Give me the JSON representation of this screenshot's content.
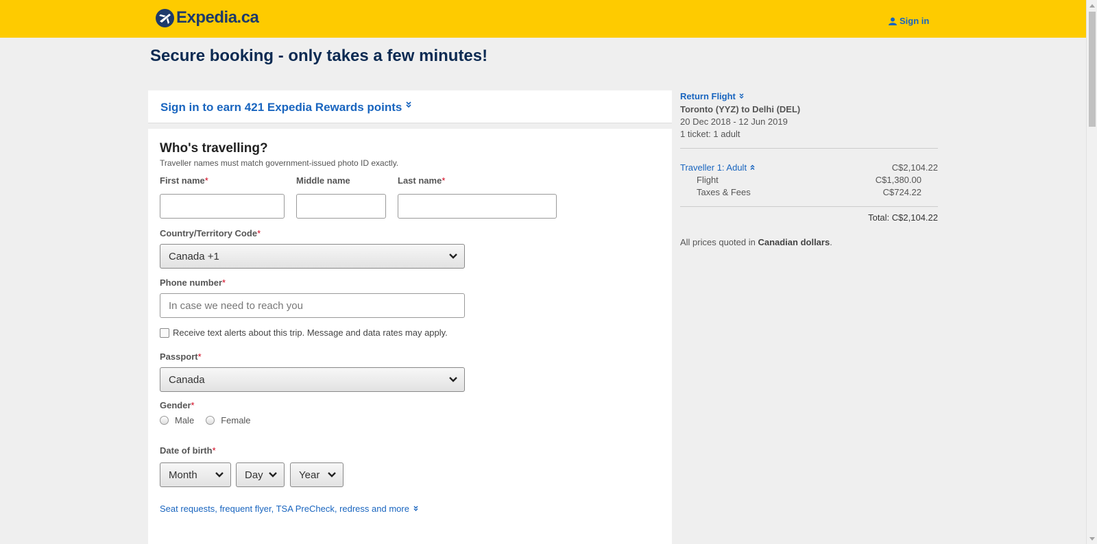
{
  "header": {
    "logo_text": "Expedia.ca",
    "signin_label": "Sign in"
  },
  "page_title": "Secure booking - only takes a few minutes!",
  "rewards": {
    "label": "Sign in to earn 421 Expedia Rewards points"
  },
  "travellers": {
    "heading": "Who's travelling?",
    "note": "Traveller names must match government-issued photo ID exactly.",
    "first_name_label": "First name",
    "middle_name_label": "Middle name",
    "last_name_label": "Last name",
    "first_name_value": "",
    "middle_name_value": "",
    "last_name_value": "",
    "country_code_label": "Country/Territory Code",
    "country_code_value": "Canada +1",
    "phone_label": "Phone number",
    "phone_placeholder": "In case we need to reach you",
    "text_alerts_label": "Receive text alerts about this trip. Message and data rates may apply.",
    "passport_label": "Passport",
    "passport_value": "Canada",
    "gender_label": "Gender",
    "gender_options": [
      "Male",
      "Female"
    ],
    "dob_label": "Date of birth",
    "dob_month": "Month",
    "dob_day": "Day",
    "dob_year": "Year",
    "required_mark": "*",
    "more_link": "Seat requests, frequent flyer, TSA PreCheck, redress and more"
  },
  "summary": {
    "title": "Return Flight",
    "route": "Toronto (YYZ) to Delhi (DEL)",
    "dates": "20 Dec 2018 - 12 Jun 2019",
    "tickets": "1 ticket: 1 adult",
    "traveller_label": "Traveller 1: Adult",
    "traveller_price": "C$2,104.22",
    "flight_label": "Flight",
    "flight_price": "C$1,380.00",
    "taxes_label": "Taxes & Fees",
    "taxes_price": "C$724.22",
    "total": "Total: C$2,104.22",
    "note_prefix": "All prices quoted in ",
    "note_bold": "Canadian dollars",
    "note_suffix": "."
  },
  "colors": {
    "header_bg": "#fecb00",
    "link": "#1965bf",
    "title": "#0c2a52",
    "required": "#d0021b"
  }
}
